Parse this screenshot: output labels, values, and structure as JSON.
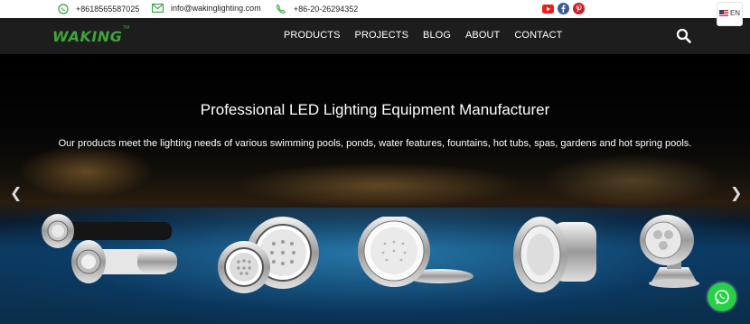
{
  "topbar": {
    "whatsapp_number": "+8618565587025",
    "email": "info@wakinglighting.com",
    "phone": "+86-20-26294352",
    "social_icons": [
      "youtube-icon",
      "facebook-icon",
      "pinterest-icon"
    ],
    "language": "EN"
  },
  "nav": {
    "logo_text": "WAKING",
    "logo_tm": "TM",
    "menu": [
      {
        "label": "PRODUCTS"
      },
      {
        "label": "PROJECTS"
      },
      {
        "label": "BLOG"
      },
      {
        "label": "ABOUT"
      },
      {
        "label": "CONTACT"
      }
    ]
  },
  "hero": {
    "headline": "Professional LED Lighting Equipment Manufacturer",
    "subheadline": "Our products meet the lighting needs of various swimming pools, ponds, water features, fountains, hot tubs, spas, gardens and hot spring pools."
  },
  "colors": {
    "brand_green": "#3fa43a",
    "nav_bg": "#1d1d1d",
    "whatsapp_green": "#27d045",
    "youtube_red": "#e62117",
    "facebook_blue": "#3b5998",
    "pinterest_red": "#cb2027"
  }
}
